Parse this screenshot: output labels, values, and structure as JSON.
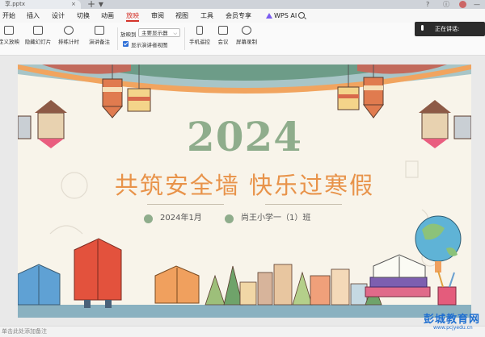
{
  "titlebar": {
    "doc_tab": "享.pptx",
    "tab_close": "×",
    "new_tab": "+ ▾"
  },
  "menubar": {
    "items": [
      "开始",
      "插入",
      "设计",
      "切换",
      "动画",
      "放映",
      "审阅",
      "视图",
      "工具",
      "会员专享"
    ],
    "active_index": 5,
    "wps_ai": "WPS AI"
  },
  "toolbar": {
    "buttons": [
      "定义放映",
      "隐藏幻灯片",
      "排练计时",
      "演讲备注",
      "手机遥控",
      "会议",
      "屏幕录制"
    ],
    "show_on_label": "放映到",
    "monitor_select": "主要显示器",
    "presenter_view_label": "显示演讲者视图",
    "presenter_view_checked": true
  },
  "toast": {
    "text": "正在讲话:"
  },
  "slide": {
    "year": "2024",
    "title": "共筑安全墙 快乐过寒假",
    "date": "2024年1月",
    "school": "尚王小学一（1）班",
    "accent_green": "#8fad8c",
    "accent_orange": "#e8934a"
  },
  "statusbar": {
    "note": "单击此处添加备注"
  },
  "watermark": {
    "text": "彭城教育网",
    "url": "www.pcjyedu.cn"
  }
}
